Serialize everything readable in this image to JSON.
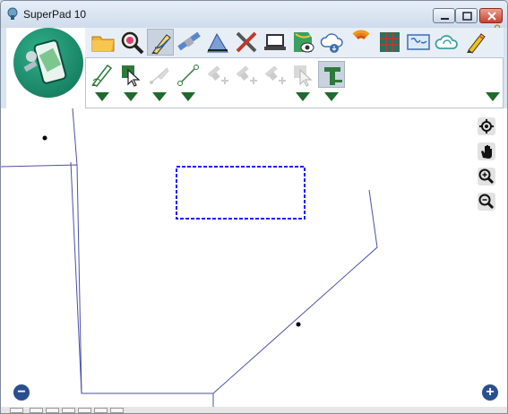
{
  "window": {
    "title": "SuperPad 10"
  },
  "toolbar": {
    "upper_icons": [
      "folder-open-icon",
      "search-zoom-icon",
      "edit-pen-icon",
      "satellite-icon",
      "ruler-triangle-icon",
      "tools-cross-icon",
      "laptop-icon",
      "map-eye-icon",
      "cloud-download-icon",
      "signal-waves-icon",
      "grid-table-icon",
      "world-map-icon",
      "cloud-sync-icon",
      "pencil-icon"
    ],
    "lower_icons": [
      "draw-pen-icon",
      "select-arrow-icon",
      "edit-vertex-disabled-icon",
      "line-draw-icon",
      "gps-point-disabled-icon",
      "gps-line-disabled-icon",
      "gps-area-disabled-icon",
      "select-disabled-icon",
      "text-tool-icon"
    ],
    "active_upper": "edit-pen-icon",
    "active_lower": "text-tool-icon"
  },
  "map": {
    "side_tools": [
      "locate-icon",
      "pan-hand-icon",
      "zoom-in-icon",
      "zoom-out-icon"
    ],
    "zoom_out_label": "−",
    "zoom_in_label": "+",
    "line_color": "#4b4fa8",
    "selection_color": "#1a1aff"
  }
}
